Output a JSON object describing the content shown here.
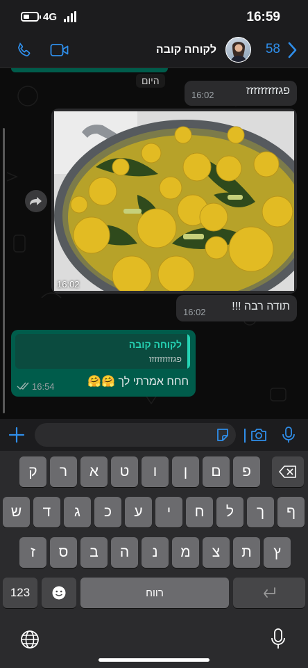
{
  "status_bar": {
    "network": "4G",
    "time": "16:59",
    "battery_level": 0.45
  },
  "header": {
    "contact_name": "לקוחה קובה",
    "unread_count": "58",
    "icons": [
      "phone-icon",
      "video-icon",
      "avatar",
      "back-chevron-icon"
    ]
  },
  "chat": {
    "day_label": "היום",
    "messages": [
      {
        "text": "פגזזזזזזזזז",
        "time": "16:02"
      },
      {
        "type": "photo",
        "time": "16:02"
      },
      {
        "text": "תודה רבה !!!",
        "time": "16:02"
      },
      {
        "reply_to_name": "לקוחה קובה",
        "reply_to_text": "פגזזזזזזזזז",
        "text": "חחח אמרתי לך 🤗🤗",
        "time": "16:54"
      }
    ]
  },
  "input": {
    "placeholder": ""
  },
  "keyboard": {
    "row1": [
      "פ",
      "ם",
      "ן",
      "ו",
      "ט",
      "א",
      "ר",
      "ק"
    ],
    "row2": [
      "ף",
      "ך",
      "ל",
      "ח",
      "י",
      "ע",
      "כ",
      "ג",
      "ד",
      "ש"
    ],
    "row3": [
      "ץ",
      "ת",
      "צ",
      "מ",
      "נ",
      "ה",
      "ב",
      "ס",
      "ז"
    ],
    "numbers_label": "123",
    "space_label": "רווח"
  },
  "colors": {
    "accent": "#2f8eea",
    "outgoing_bubble": "#005c4b",
    "incoming_bubble": "#2b2b2d",
    "reply_accent": "#25d3b4"
  }
}
